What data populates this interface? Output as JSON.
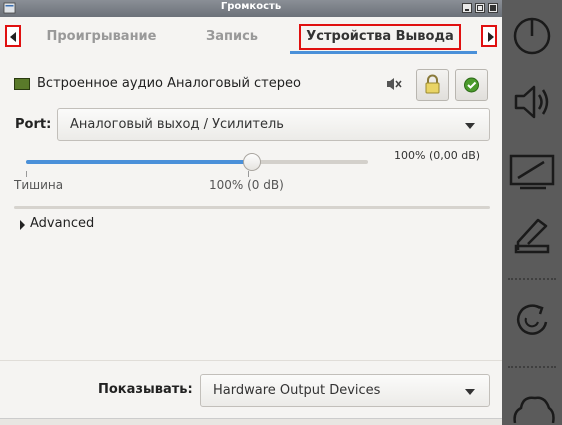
{
  "window": {
    "title": "Громкость"
  },
  "tabs": [
    {
      "label": "Проигрывание",
      "active": false
    },
    {
      "label": "Запись",
      "active": false
    },
    {
      "label": "Устройства Вывода",
      "active": true
    }
  ],
  "device": {
    "name": "Встроенное аудио Аналоговый стерео",
    "port_label": "Port:",
    "port_value": "Аналоговый выход / Усилитель",
    "volume_readout": "100% (0,00 dB)",
    "volume_fraction": 0.66,
    "silence_label": "Тишина",
    "reference_label": "100% (0 dB)",
    "advanced_label": "Advanced"
  },
  "footer": {
    "show_label": "Показывать:",
    "show_value": "Hardware Output Devices"
  },
  "dock": {
    "items": [
      "power-icon",
      "speaker-icon",
      "display-icon",
      "scanner-icon",
      "refresh-icon",
      "cloud-icon"
    ]
  },
  "colors": {
    "accent": "#4a90d9",
    "highlight": "#e01010",
    "dock_bg": "#5b5b5b"
  }
}
